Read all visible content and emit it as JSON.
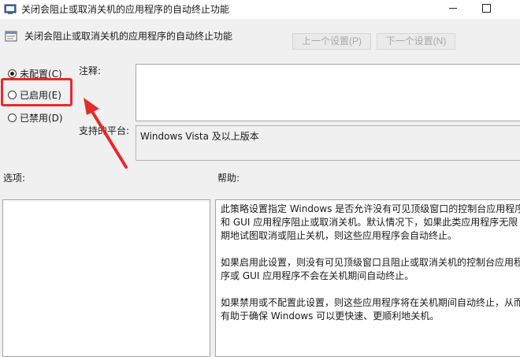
{
  "window": {
    "title": "关闭会阻止或取消关机的应用程序的自动终止功能"
  },
  "header": {
    "policy_name": "关闭会阻止或取消关机的应用程序的自动终止功能",
    "prev_setting": "上一个设置(P)",
    "next_setting": "下一个设置(N)"
  },
  "state_options": {
    "not_configured": "未配置(C)",
    "enabled": "已启用(E)",
    "disabled": "已禁用(D)",
    "selected": "not_configured"
  },
  "fields": {
    "comment_label": "注释:",
    "comment_value": "",
    "supported_label": "支持的平台:",
    "supported_value": "Windows Vista 及以上版本"
  },
  "sections": {
    "options_label": "选项:",
    "help_label": "帮助:"
  },
  "help": {
    "paragraphs": [
      "此策略设置指定 Windows 是否允许没有可见顶级窗口的控制台应用程序和 GUI 应用程序阻止或取消关机。默认情况下，如果此类应用程序无限期地试图取消或阻止关机，则这些应用程序会自动终止。",
      "如果启用此设置，则没有可见顶级窗口且阻止或取消关机的控制台应用程序或 GUI 应用程序不会在关机期间自动终止。",
      "如果禁用或不配置此设置，则这些应用程序将在关机期间自动终止，从而有助于确保 Windows 可以更快速、更顺利地关机。"
    ]
  },
  "colors": {
    "annotation_red": "#e52b2b",
    "window_bg": "#f0f0f0",
    "disabled_text": "#a8a8a8"
  }
}
